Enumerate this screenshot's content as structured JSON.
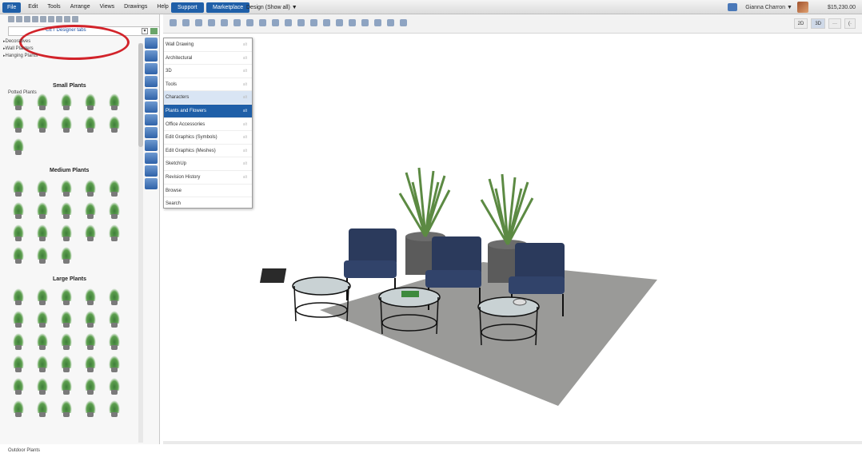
{
  "menubar": {
    "items": [
      "File",
      "Edit",
      "Tools",
      "Arrange",
      "Views",
      "Drawings",
      "Help"
    ],
    "support": "Support",
    "marketplace": "Marketplace",
    "design": "Design (Show all) ▼"
  },
  "user": {
    "name": "Gianna Charron ▼",
    "price": "$15,230.00"
  },
  "view_buttons": [
    "2D",
    "3D",
    "···",
    "(·"
  ],
  "selector": {
    "label": "CET Designer tabs"
  },
  "tree": [
    "Decoratives",
    "Wall Planters",
    "Hanging Plants"
  ],
  "potted": "Potted Plants",
  "sections": {
    "small": "Small Plants",
    "medium": "Medium Plants",
    "large": "Large Plants"
  },
  "outdoor": "Outdoor Plants",
  "dropdown": {
    "items": [
      {
        "label": "Wall Drawing",
        "key": "alt"
      },
      {
        "label": "Architectural",
        "key": "alt"
      },
      {
        "label": "3D",
        "key": "alt"
      },
      {
        "label": "Tools",
        "key": "alt"
      },
      {
        "label": "Characters",
        "key": "alt"
      },
      {
        "label": "Plants and Flowers",
        "key": "alt"
      },
      {
        "label": "Office Accessories",
        "key": "alt"
      },
      {
        "label": "Edit Graphics (Symbols)",
        "key": "alt"
      },
      {
        "label": "Edit Graphics (Meshes)",
        "key": "alt"
      },
      {
        "label": "SketchUp",
        "key": "alt"
      },
      {
        "label": "Revision History",
        "key": "alt"
      },
      {
        "label": "Browse",
        "key": ""
      },
      {
        "label": "Search",
        "key": ""
      }
    ]
  },
  "colors": {
    "accent": "#1f5fa8",
    "highlight": "#d2232a"
  }
}
